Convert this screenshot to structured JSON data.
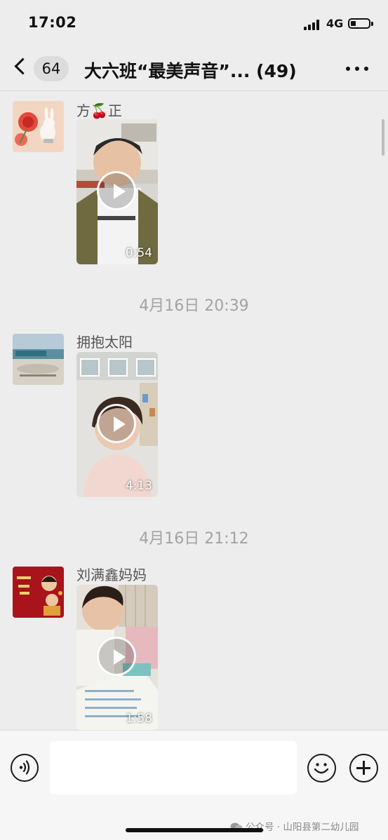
{
  "status_bar": {
    "time": "17:02",
    "network": "4G",
    "battery_level": 0.3
  },
  "nav": {
    "unread_count": "64",
    "title": "大六班“最美声音”... (49)"
  },
  "messages": [
    {
      "sender": "方🍒正",
      "duration": "0:54"
    },
    {
      "timestamp": "4月16日 20:39",
      "sender": "拥抱太阳",
      "duration": "4:13"
    },
    {
      "timestamp": "4月16日 21:12",
      "sender": "刘满鑫妈妈",
      "duration": "1:58"
    }
  ],
  "input": {
    "placeholder": ""
  },
  "watermark": "公众号 · 山阳县第二幼儿园"
}
